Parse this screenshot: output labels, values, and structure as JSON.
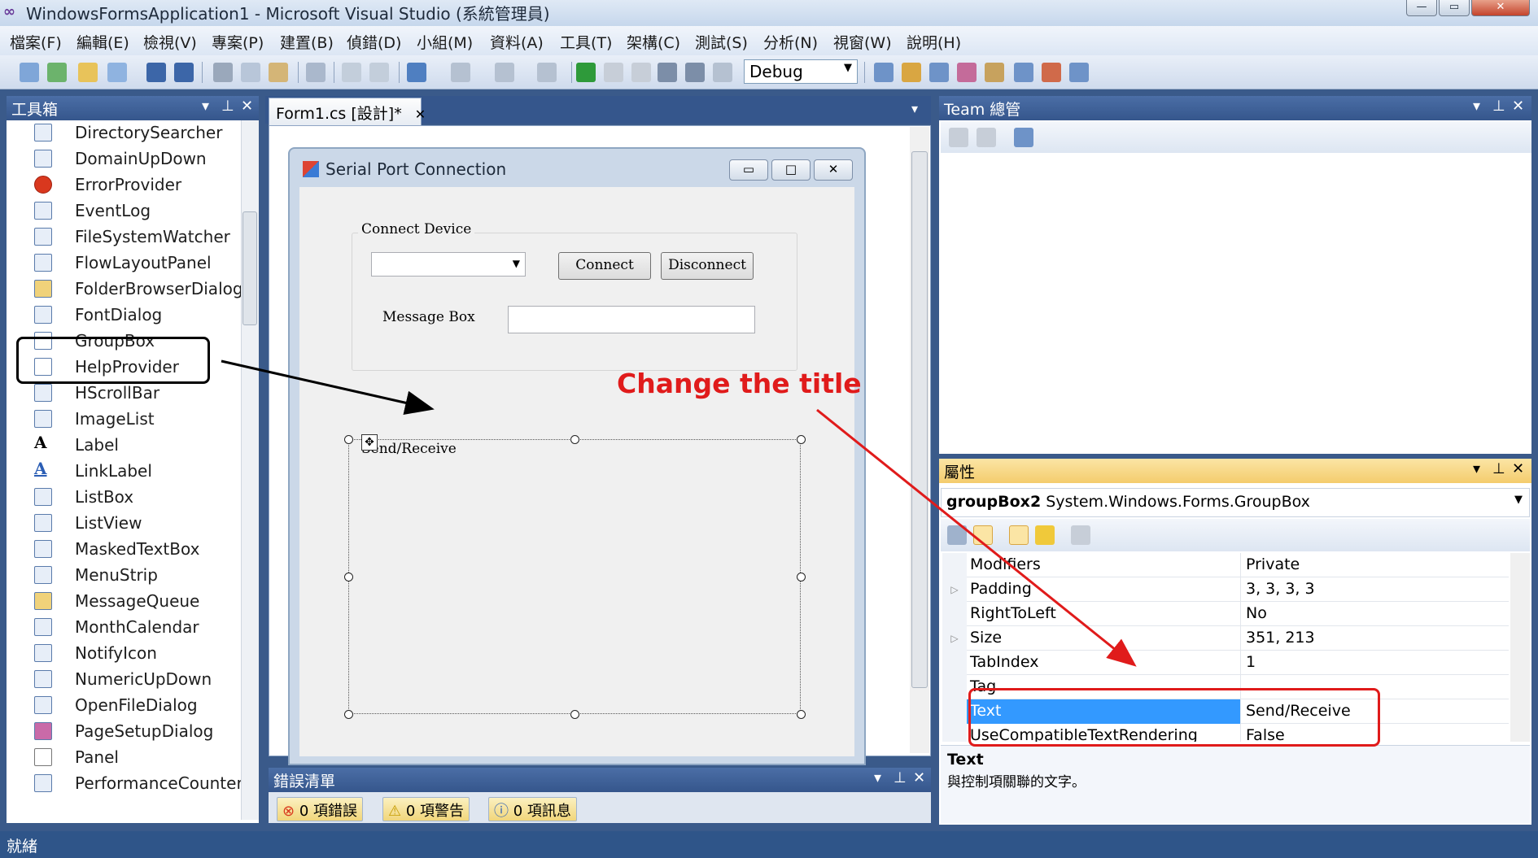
{
  "window": {
    "title": "WindowsFormsApplication1 - Microsoft Visual Studio (系統管理員)",
    "controls": [
      "—",
      "▭",
      "✕"
    ]
  },
  "menu": [
    "檔案(F)",
    "編輯(E)",
    "檢視(V)",
    "專案(P)",
    "建置(B)",
    "偵錯(D)",
    "小組(M)",
    "資料(A)",
    "工具(T)",
    "架構(C)",
    "測試(S)",
    "分析(N)",
    "視窗(W)",
    "說明(H)"
  ],
  "toolbar": {
    "configuration": "Debug",
    "icons": [
      "new-project-icon",
      "add-item-icon",
      "open-file-icon",
      "add-existing-icon",
      "save-icon",
      "save-all-icon",
      "cut-icon",
      "copy-icon",
      "paste-icon",
      "find-icon",
      "comment-icon",
      "uncomment-icon",
      "undo-icon",
      "redo-icon",
      "navigate-back-icon",
      "navigate-forward-icon",
      "start-debugging-icon",
      "pause-icon",
      "stop-icon",
      "solution-explorer-icon",
      "properties-icon",
      "object-browser-icon",
      "toolbox-icon",
      "team-explorer-icon",
      "class-view-icon",
      "extension-icon",
      "output-icon"
    ]
  },
  "toolbox": {
    "header": "工具箱",
    "items": [
      "DirectorySearcher",
      "DomainUpDown",
      "ErrorProvider",
      "EventLog",
      "FileSystemWatcher",
      "FlowLayoutPanel",
      "FolderBrowserDialog",
      "FontDialog",
      "GroupBox",
      "HelpProvider",
      "HScrollBar",
      "ImageList",
      "Label",
      "LinkLabel",
      "ListBox",
      "ListView",
      "MaskedTextBox",
      "MenuStrip",
      "MessageQueue",
      "MonthCalendar",
      "NotifyIcon",
      "NumericUpDown",
      "OpenFileDialog",
      "PageSetupDialog",
      "Panel",
      "PerformanceCounter"
    ]
  },
  "designer": {
    "tab_label": "Form1.cs [設計]*",
    "form_title": "Serial Port Connection",
    "group1_title": "Connect Device",
    "connect_button": "Connect",
    "disconnect_button": "Disconnect",
    "message_label": "Message Box",
    "group2_title": "Send/Receive",
    "annotation": "Change the title",
    "annotation_color": "#e01b1b"
  },
  "error_list": {
    "header": "錯誤清單",
    "errors": "0 項錯誤",
    "warnings": "0 項警告",
    "messages": "0 項訊息"
  },
  "team_explorer": {
    "header": "Team 總管"
  },
  "properties": {
    "header": "屬性",
    "object_name": "groupBox2",
    "object_type": "System.Windows.Forms.GroupBox",
    "rows": [
      {
        "name": "Modifiers",
        "value": "Private",
        "expandable": false,
        "selected": false
      },
      {
        "name": "Padding",
        "value": "3, 3, 3, 3",
        "expandable": true,
        "selected": false
      },
      {
        "name": "RightToLeft",
        "value": "No",
        "expandable": false,
        "selected": false
      },
      {
        "name": "Size",
        "value": "351, 213",
        "expandable": true,
        "selected": false
      },
      {
        "name": "TabIndex",
        "value": "1",
        "expandable": false,
        "selected": false
      },
      {
        "name": "Tag",
        "value": "",
        "expandable": false,
        "selected": false
      },
      {
        "name": "Text",
        "value": "Send/Receive",
        "expandable": false,
        "selected": true
      },
      {
        "name": "UseCompatibleTextRendering",
        "value": "False",
        "expandable": false,
        "selected": false
      }
    ],
    "description_title": "Text",
    "description_text": "與控制項關聯的文字。"
  },
  "status": "就緒"
}
